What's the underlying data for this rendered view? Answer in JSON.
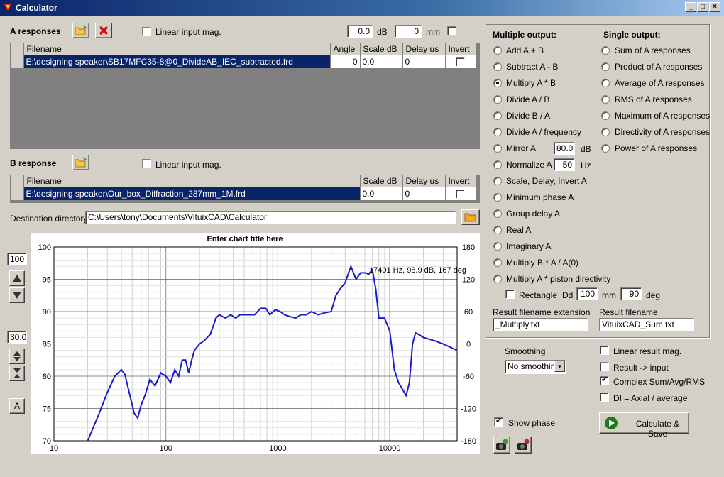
{
  "window": {
    "title": "Calculator"
  },
  "a_responses": {
    "label": "A responses",
    "linear_label": "Linear input mag.",
    "db_value": "0.0",
    "db_unit": "dB",
    "mm_value": "0",
    "mm_unit": "mm",
    "headers": [
      "Filename",
      "Angle",
      "Scale dB",
      "Delay us",
      "Invert"
    ],
    "rows": [
      {
        "filename": "E:\\designing speaker\\SB17MFC35-8@0_DivideAB_IEC_subtracted.frd",
        "angle": "0",
        "scale": "0.0",
        "delay": "0"
      }
    ]
  },
  "b_response": {
    "label": "B response",
    "linear_label": "Linear input mag.",
    "headers": [
      "Filename",
      "Scale dB",
      "Delay us",
      "Invert"
    ],
    "rows": [
      {
        "filename": "E:\\designing speaker\\Our_box_Diffraction_287mm_1M.frd",
        "scale": "0.0",
        "delay": "0"
      }
    ]
  },
  "destination": {
    "label": "Destination directory",
    "path": "C:\\Users\\tony\\Documents\\VituixCAD\\Calculator"
  },
  "multiple_output": {
    "title": "Multiple output:",
    "options": [
      "Add A + B",
      "Subtract A - B",
      "Multiply A * B",
      "Divide A / B",
      "Divide B / A",
      "Divide A / frequency",
      "Mirror A",
      "Normalize A",
      "Scale, Delay, Invert A",
      "Minimum phase A",
      "Group delay A",
      "Real A",
      "Imaginary A",
      "Multiply B * A / A(0)",
      "Multiply A * piston directivity"
    ],
    "selected": "Multiply A * B",
    "mirror_value": "80.0",
    "mirror_unit": "dB",
    "normalize_value": "50",
    "normalize_unit": "Hz",
    "rectangle_label": "Rectangle",
    "dd_label": "Dd",
    "dd_value": "100",
    "dd_unit": "mm",
    "deg_value": "90",
    "deg_unit": "deg"
  },
  "single_output": {
    "title": "Single output:",
    "options": [
      "Sum of A responses",
      "Product of A responses",
      "Average of A responses",
      "RMS of A responses",
      "Maximum of A responses",
      "Directivity of A responses",
      "Power of A responses"
    ]
  },
  "result": {
    "ext_label": "Result filename extension",
    "ext_value": "_Multiply.txt",
    "name_label": "Result filename",
    "name_value": "VituixCAD_Sum.txt"
  },
  "smoothing": {
    "label": "Smoothing",
    "value": "No smoothing"
  },
  "options": {
    "linear_result": "Linear result mag.",
    "result_input": "Result -> input",
    "complex": "Complex Sum/Avg/RMS",
    "di": "DI = Axial / average",
    "show_phase": "Show phase"
  },
  "calc_button": "Calculate & Save",
  "left_controls": {
    "top_value": "100",
    "range_value": "30.0",
    "auto_label": "A"
  },
  "chart_data": {
    "type": "line",
    "title": "Enter chart title here",
    "xscale": "log",
    "xlim": [
      10,
      40000
    ],
    "ylim": [
      70,
      100
    ],
    "y2lim": [
      -180,
      180
    ],
    "xticks": [
      "10",
      "100",
      "1000",
      "10000"
    ],
    "yticks": [
      "100",
      "95",
      "90",
      "85",
      "80",
      "75",
      "70"
    ],
    "y2ticks": [
      "180",
      "120",
      "60",
      "0",
      "-60",
      "-120",
      "-180"
    ],
    "annotation": "17401 Hz, 98.9 dB, 167 deg",
    "series": [
      {
        "color": "#1a1acc",
        "x": [
          20,
          25,
          30,
          35,
          40,
          43,
          47,
          52,
          56,
          60,
          65,
          72,
          80,
          90,
          100,
          110,
          120,
          130,
          140,
          150,
          160,
          170,
          180,
          200,
          220,
          250,
          280,
          300,
          340,
          380,
          420,
          460,
          500,
          560,
          620,
          700,
          780,
          850,
          950,
          1050,
          1150,
          1300,
          1450,
          1600,
          1800,
          2000,
          2300,
          2600,
          3000,
          3300,
          3600,
          4000,
          4500,
          5000,
          5500,
          6000,
          6500,
          7000,
          7500,
          8000,
          8500,
          9000,
          10000,
          11000,
          12000,
          13000,
          14000,
          15000,
          16000,
          17000,
          18000,
          20000,
          25000,
          30000,
          40000
        ],
        "y": [
          70.0,
          74.0,
          77.5,
          80.0,
          81.0,
          80.3,
          77.5,
          74.3,
          73.5,
          75.5,
          77.0,
          79.5,
          78.5,
          80.5,
          80.0,
          79.0,
          81.0,
          80.0,
          82.5,
          82.5,
          80.5,
          82.5,
          84.0,
          85.0,
          85.5,
          86.5,
          89.0,
          89.5,
          89.0,
          89.5,
          89.0,
          89.5,
          89.5,
          89.5,
          89.5,
          90.5,
          90.5,
          89.5,
          90.3,
          90.0,
          89.5,
          89.2,
          89.0,
          89.5,
          89.5,
          90.0,
          89.5,
          89.8,
          90.0,
          92.5,
          93.5,
          94.5,
          97.0,
          95.0,
          96.0,
          96.0,
          95.8,
          96.5,
          93.5,
          89.0,
          89.0,
          89.0,
          87.0,
          81.0,
          79.0,
          78.0,
          77.0,
          79.0,
          85.0,
          86.7,
          86.5,
          86.0,
          85.5,
          85.0,
          84.0
        ]
      }
    ]
  }
}
